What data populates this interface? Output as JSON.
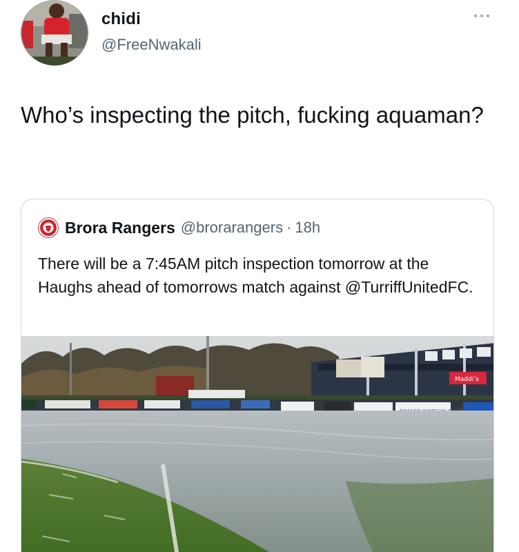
{
  "tweet": {
    "author_name": "chidi",
    "author_handle": "@FreeNwakali",
    "text": "Who’s inspecting the pitch, fucking aquaman?",
    "avatar_icon": "profile-photo-red-kit-player",
    "more_icon": "more-horizontal-icon"
  },
  "quoted_tweet": {
    "author_name": "Brora Rangers",
    "author_handle": "@brorarangers",
    "separator": "·",
    "time": "18h",
    "text": "There will be a 7:45AM pitch inspection tomorrow at the Haughs ahead of tomorrows match against @TurriffUnitedFC.",
    "logo_icon": "club-crest-icon",
    "photo": {
      "description_icon": "flooded-football-pitch-photo",
      "banners": [
        "Maddi’s",
        "FRASER-WATSON ELECTRICAL"
      ]
    }
  },
  "colors": {
    "text_primary": "#0f1419",
    "text_secondary": "#536471",
    "border": "#cfd9de",
    "grass": "#4f7a2c",
    "water": "#9ea7ab"
  }
}
